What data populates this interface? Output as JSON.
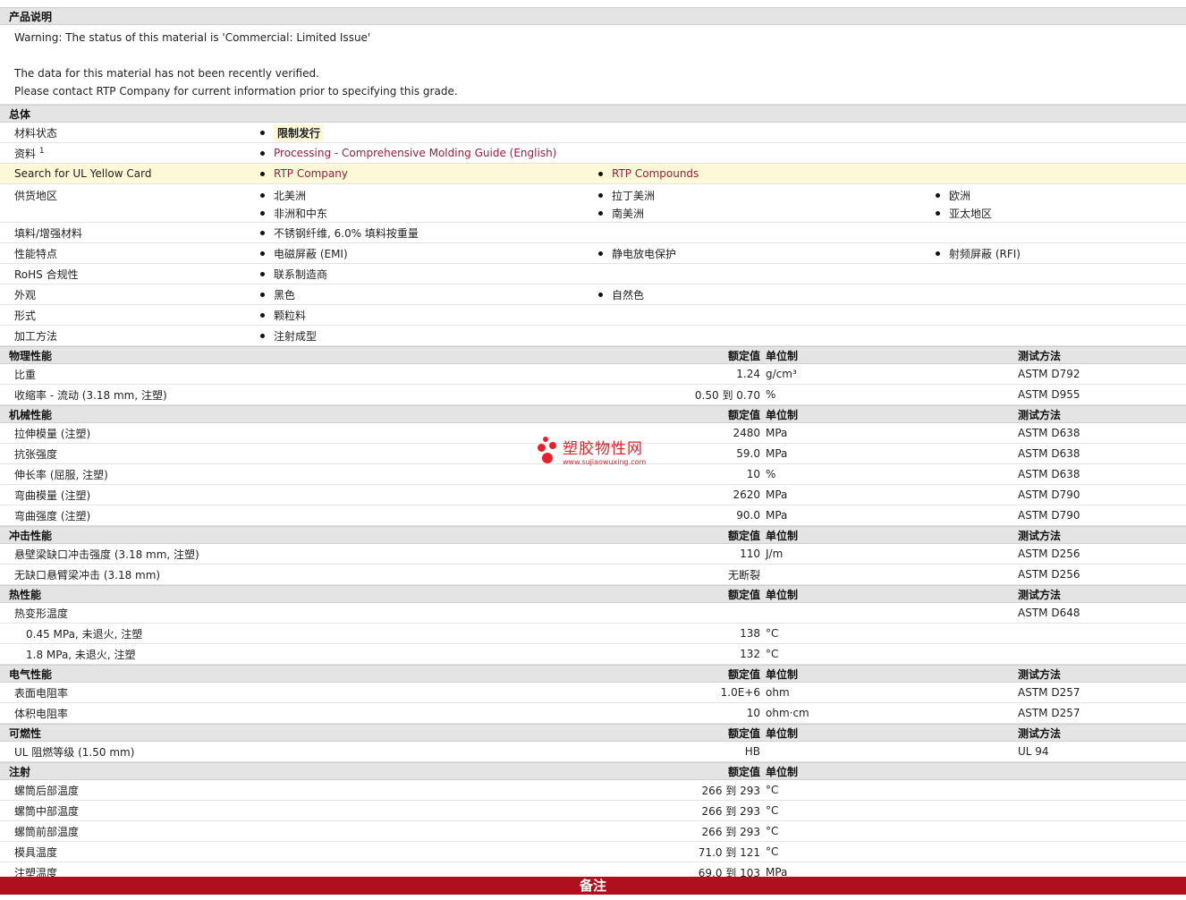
{
  "product": {
    "title": "产品说明",
    "lines": [
      "Warning: The status of this material is 'Commercial: Limited Issue'",
      "",
      "The data for this material has not been recently verified.",
      "Please contact RTP Company for current information prior to specifying this grade."
    ]
  },
  "general": {
    "title": "总体",
    "rows": [
      {
        "label": "材料状态",
        "items": [
          "限制发行"
        ]
      },
      {
        "label": "资料",
        "sup": "1",
        "items": [
          "Processing - Comprehensive Molding Guide (English)"
        ]
      },
      {
        "label": "Search for UL Yellow Card",
        "items": [
          "RTP Company",
          "RTP Compounds"
        ]
      },
      {
        "label": "供货地区",
        "items": [
          "北美洲",
          "拉丁美洲",
          "欧洲",
          "非洲和中东",
          "南美洲",
          "亚太地区"
        ]
      },
      {
        "label": "填料/增强材料",
        "items": [
          "不锈钢纤维, 6.0% 填料按重量"
        ]
      },
      {
        "label": "性能特点",
        "items": [
          "电磁屏蔽 (EMI)",
          "静电放电保护",
          "射频屏蔽 (RFI)"
        ]
      },
      {
        "label": "RoHS 合规性",
        "items": [
          "联系制造商"
        ]
      },
      {
        "label": "外观",
        "items": [
          "黑色",
          "自然色"
        ]
      },
      {
        "label": "形式",
        "items": [
          "颗粒料"
        ]
      },
      {
        "label": "加工方法",
        "items": [
          "注射成型"
        ]
      }
    ]
  },
  "headers": {
    "value": "额定值",
    "unit": "单位制",
    "test": "测试方法"
  },
  "sections": [
    {
      "title": "物理性能",
      "rows": [
        {
          "label": "比重",
          "value": "1.24",
          "unit": "g/cm³",
          "test": "ASTM D792"
        },
        {
          "label": "收缩率 - 流动 (3.18 mm, 注塑)",
          "value": "0.50 到 0.70",
          "unit": "%",
          "test": "ASTM D955"
        }
      ]
    },
    {
      "title": "机械性能",
      "rows": [
        {
          "label": "拉伸模量 (注塑)",
          "value": "2480",
          "unit": "MPa",
          "test": "ASTM D638"
        },
        {
          "label": "抗张强度",
          "value": "59.0",
          "unit": "MPa",
          "test": "ASTM D638"
        },
        {
          "label": "伸长率 (屈服, 注塑)",
          "value": "10",
          "unit": "%",
          "test": "ASTM D638"
        },
        {
          "label": "弯曲模量 (注塑)",
          "value": "2620",
          "unit": "MPa",
          "test": "ASTM D790"
        },
        {
          "label": "弯曲强度 (注塑)",
          "value": "90.0",
          "unit": "MPa",
          "test": "ASTM D790"
        }
      ]
    },
    {
      "title": "冲击性能",
      "rows": [
        {
          "label": "悬壁梁缺口冲击强度 (3.18 mm, 注塑)",
          "value": "110",
          "unit": "J/m",
          "test": "ASTM D256"
        },
        {
          "label": "无缺口悬臂梁冲击 (3.18 mm)",
          "value": "无断裂",
          "unit": "",
          "test": "ASTM D256"
        }
      ]
    },
    {
      "title": "热性能",
      "rows": [
        {
          "label": "热变形温度",
          "value": "",
          "unit": "",
          "test": "ASTM D648"
        },
        {
          "label": "0.45 MPa, 未退火, 注塑",
          "indent": true,
          "value": "138",
          "unit": "°C",
          "test": ""
        },
        {
          "label": "1.8 MPa, 未退火, 注塑",
          "indent": true,
          "value": "132",
          "unit": "°C",
          "test": ""
        }
      ]
    },
    {
      "title": "电气性能",
      "rows": [
        {
          "label": "表面电阻率",
          "value": "1.0E+6",
          "unit": "ohm",
          "test": "ASTM D257"
        },
        {
          "label": "体积电阻率",
          "value": "10",
          "unit": "ohm·cm",
          "test": "ASTM D257"
        }
      ]
    },
    {
      "title": "可燃性",
      "rows": [
        {
          "label": "UL 阻燃等级 (1.50 mm)",
          "value": "HB",
          "unit": "",
          "test": "UL 94"
        }
      ]
    },
    {
      "title": "注射",
      "noTest": true,
      "rows": [
        {
          "label": "螺筒后部温度",
          "value": "266 到 293",
          "unit": "°C",
          "test": ""
        },
        {
          "label": "螺筒中部温度",
          "value": "266 到 293",
          "unit": "°C",
          "test": ""
        },
        {
          "label": "螺筒前部温度",
          "value": "266 到 293",
          "unit": "°C",
          "test": ""
        },
        {
          "label": "模具温度",
          "value": "71.0 到 121",
          "unit": "°C",
          "test": ""
        },
        {
          "label": "注塑温度",
          "value": "69.0 到 103",
          "unit": "MPa",
          "test": ""
        }
      ]
    }
  ],
  "footer": {
    "label": "备注"
  },
  "watermark": {
    "cn": "塑胶物性网",
    "url": "www.sujiaowuxing.com"
  }
}
